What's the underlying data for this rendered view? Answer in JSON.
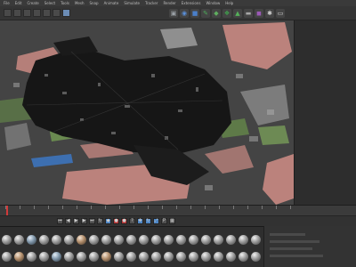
{
  "menu": [
    {
      "label": "File"
    },
    {
      "label": "Edit"
    },
    {
      "label": "Create"
    },
    {
      "label": "Select"
    },
    {
      "label": "Tools"
    },
    {
      "label": "Mesh"
    },
    {
      "label": "Snap"
    },
    {
      "label": "Animate"
    },
    {
      "label": "Simulate"
    },
    {
      "label": "Tracker"
    },
    {
      "label": "Render"
    },
    {
      "label": "Extensions"
    },
    {
      "label": "Window"
    },
    {
      "label": "Help"
    }
  ],
  "toolbar": {
    "left_buttons": [
      "undo-icon",
      "redo-icon",
      "live-select-icon",
      "move-icon",
      "scale-icon",
      "rotate-icon",
      "active-tool-icon"
    ],
    "right_icons": [
      {
        "name": "render-view-icon",
        "glyph": "▣",
        "color": "#9aa0a6"
      },
      {
        "name": "render-icon",
        "glyph": "◉",
        "color": "#5a8fd8"
      },
      {
        "name": "cube-icon",
        "glyph": "■",
        "color": "#4a7fc9"
      },
      {
        "name": "pen-icon",
        "glyph": "✎",
        "color": "#4cab5a"
      },
      {
        "name": "subdivision-icon",
        "glyph": "◆",
        "color": "#5fae5f"
      },
      {
        "name": "cloner-icon",
        "glyph": "❖",
        "color": "#3fa34d"
      },
      {
        "name": "deformer-icon",
        "glyph": "▲",
        "color": "#55b05a"
      },
      {
        "name": "floor-icon",
        "glyph": "▬",
        "color": "#a6a6a6"
      },
      {
        "name": "camera-icon",
        "glyph": "◼",
        "color": "#9b59b6"
      },
      {
        "name": "light-icon",
        "glyph": "✱",
        "color": "#d0d0d0"
      },
      {
        "name": "display-icon",
        "glyph": "▭",
        "color": "#cfcfcf"
      }
    ]
  },
  "timeline": {
    "playhead_fraction": 0.02
  },
  "playback": {
    "buttons": [
      {
        "name": "go-to-start-button",
        "glyph": "⏮",
        "style": ""
      },
      {
        "name": "prev-frame-button",
        "glyph": "◀",
        "style": ""
      },
      {
        "name": "play-button",
        "glyph": "▶",
        "style": ""
      },
      {
        "name": "next-frame-button",
        "glyph": "▶",
        "style": ""
      },
      {
        "name": "go-to-end-button",
        "glyph": "⏭",
        "style": ""
      },
      {
        "name": "loop-button",
        "glyph": "↻",
        "style": ""
      },
      {
        "name": "keyframe-mode-button",
        "glyph": "◆",
        "style": "blue"
      },
      {
        "name": "record-button",
        "glyph": "●",
        "style": "red"
      },
      {
        "name": "auto-key-button",
        "glyph": "●",
        "style": "red"
      },
      {
        "name": "key-options-button",
        "glyph": "?",
        "style": ""
      },
      {
        "name": "position-key-button",
        "glyph": "✥",
        "style": "blue"
      },
      {
        "name": "rotation-key-button",
        "glyph": "↻",
        "style": "blue"
      },
      {
        "name": "scale-key-button",
        "glyph": "⤢",
        "style": "blue"
      },
      {
        "name": "param-key-button",
        "glyph": "P",
        "style": ""
      },
      {
        "name": "pla-key-button",
        "glyph": "▦",
        "style": ""
      }
    ]
  },
  "materials": {
    "row1": [
      "",
      "",
      "cool",
      "",
      "",
      "",
      "warm",
      "",
      "",
      "",
      "",
      "",
      "",
      "",
      "",
      "",
      "",
      "",
      "",
      "",
      ""
    ],
    "row2": [
      "",
      "warm",
      "",
      "",
      "cool",
      "",
      "",
      "",
      "warm",
      "",
      "",
      "",
      "",
      "",
      "",
      "",
      "",
      "",
      "",
      "",
      ""
    ]
  },
  "colors": {
    "viewport_bg": "#444444",
    "city_dense": "#161616",
    "terrain_pink": "#c98a83",
    "terrain_green": "#5e7a48",
    "water_blue": "#3d6fb0"
  }
}
